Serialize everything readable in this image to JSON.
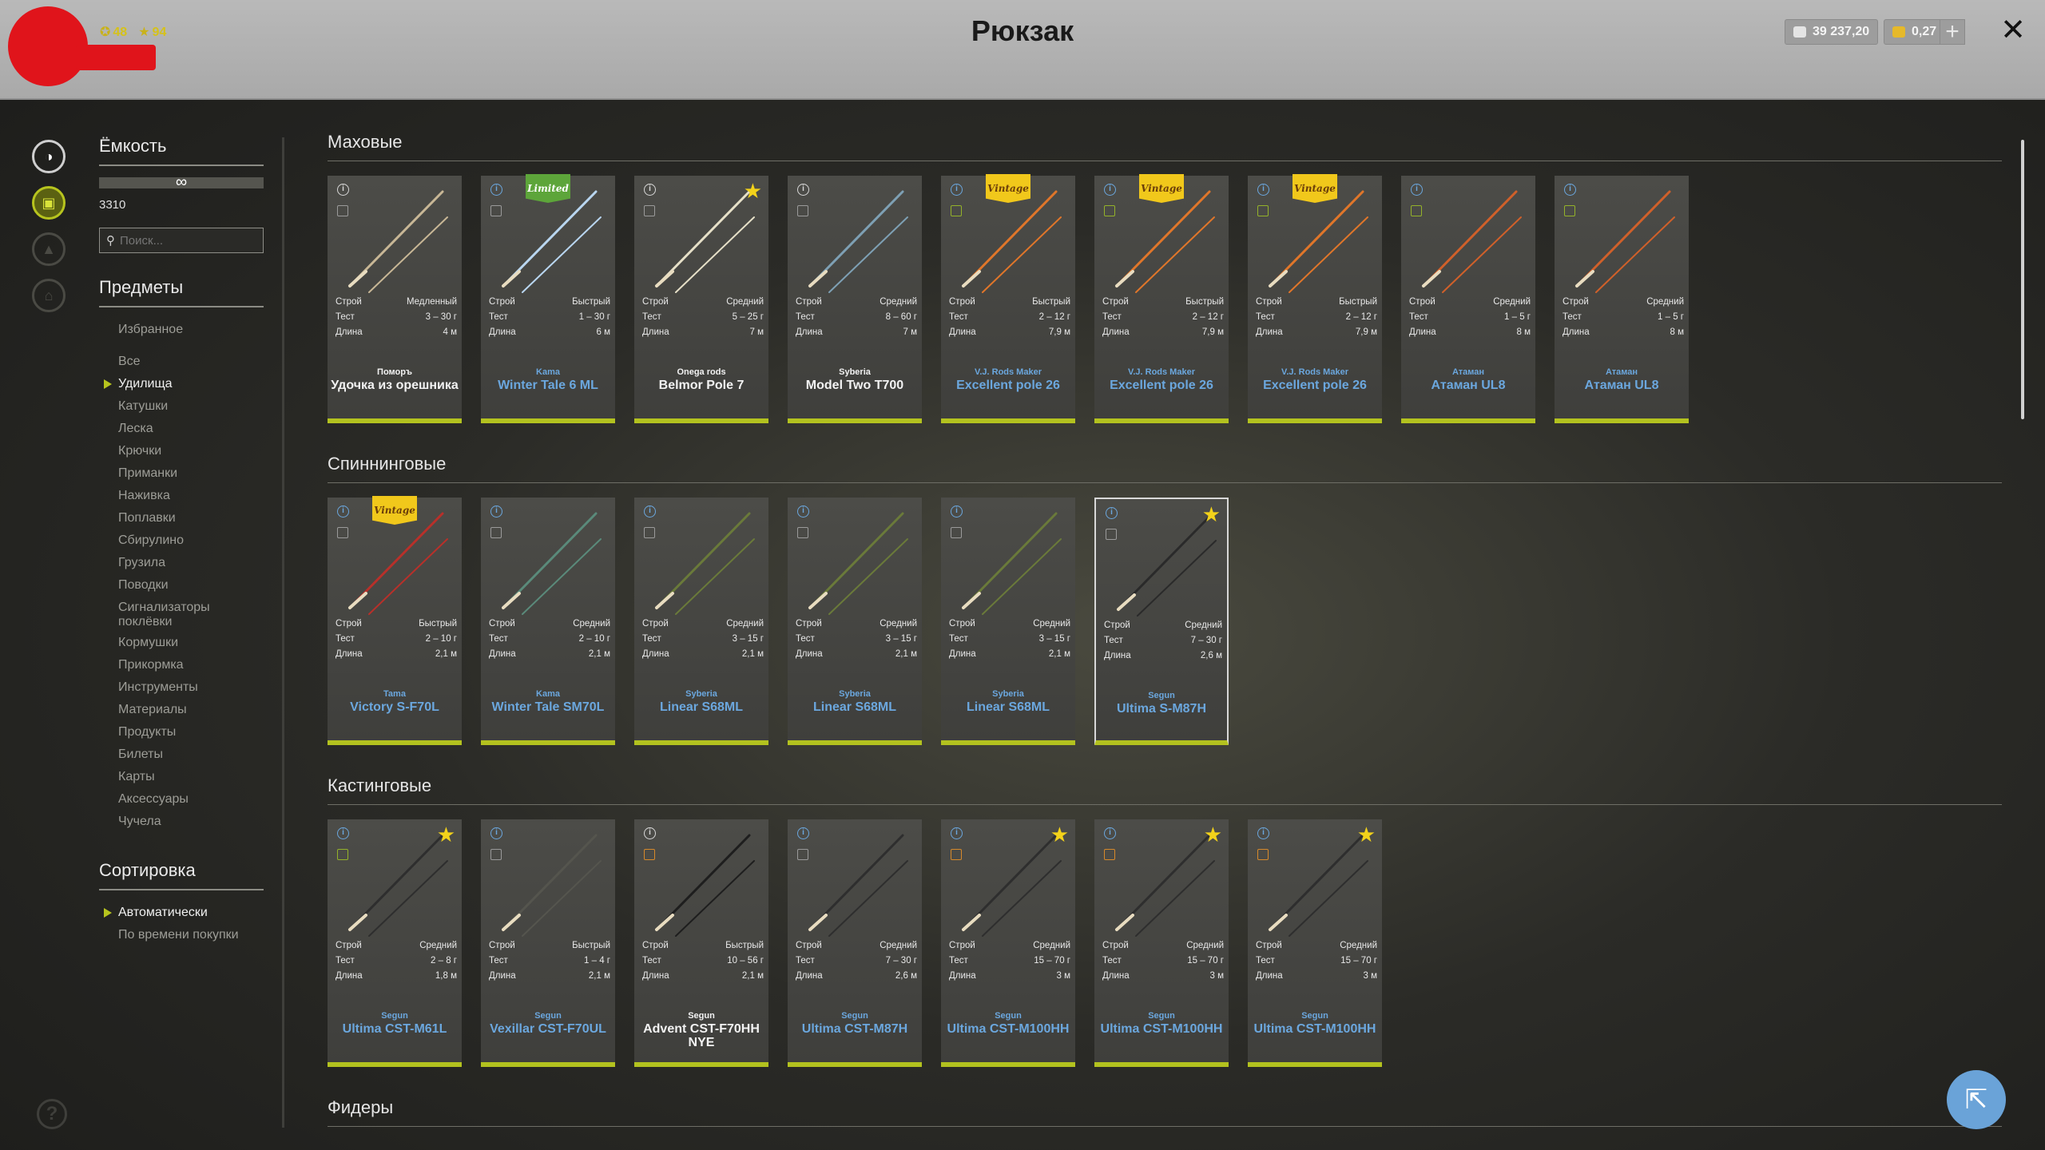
{
  "header": {
    "title": "Рюкзак",
    "level": "48",
    "rating": "94",
    "silver": "39 237,20",
    "gold": "0,27",
    "plus": "+",
    "close": "✕"
  },
  "sidebar": {
    "capacity_title": "Ёмкость",
    "capacity_bar": "∞",
    "capacity_value": "3310",
    "search_placeholder": "Поиск...",
    "items_title": "Предметы",
    "favorites": "Избранное",
    "items": [
      {
        "label": "Все",
        "active": false
      },
      {
        "label": "Удилища",
        "active": true
      },
      {
        "label": "Катушки",
        "active": false
      },
      {
        "label": "Леска",
        "active": false
      },
      {
        "label": "Крючки",
        "active": false
      },
      {
        "label": "Приманки",
        "active": false
      },
      {
        "label": "Наживка",
        "active": false
      },
      {
        "label": "Поплавки",
        "active": false
      },
      {
        "label": "Сбирулино",
        "active": false
      },
      {
        "label": "Грузила",
        "active": false
      },
      {
        "label": "Поводки",
        "active": false
      },
      {
        "label": "Сигнализаторы поклёвки",
        "active": false
      },
      {
        "label": "Кормушки",
        "active": false
      },
      {
        "label": "Прикормка",
        "active": false
      },
      {
        "label": "Инструменты",
        "active": false
      },
      {
        "label": "Материалы",
        "active": false
      },
      {
        "label": "Продукты",
        "active": false
      },
      {
        "label": "Билеты",
        "active": false
      },
      {
        "label": "Карты",
        "active": false
      },
      {
        "label": "Аксессуары",
        "active": false
      },
      {
        "label": "Чучела",
        "active": false
      }
    ],
    "sort_title": "Сортировка",
    "sort_options": [
      {
        "label": "Автоматически",
        "active": true
      },
      {
        "label": "По времени покупки",
        "active": false
      }
    ]
  },
  "spec_labels": {
    "action": "Строй",
    "test": "Тест",
    "length": "Длина"
  },
  "categories": [
    {
      "title": "Маховые",
      "items": [
        {
          "brand": "Поморъ",
          "model": "Удочка из орешника",
          "action": "Медленный",
          "test": "3 – 30 г",
          "length": "4 м",
          "white": true,
          "info_blue": false,
          "copy": "",
          "star": false,
          "badge": "",
          "rod": "#c8b796"
        },
        {
          "brand": "Kama",
          "model": "Winter Tale 6 ML",
          "action": "Быстрый",
          "test": "1 – 30 г",
          "length": "6 м",
          "white": false,
          "info_blue": true,
          "copy": "",
          "star": false,
          "badge": "Limited",
          "rod": "#b9d6f0"
        },
        {
          "brand": "Onega rods",
          "model": "Belmor Pole 7",
          "action": "Средний",
          "test": "5 – 25 г",
          "length": "7 м",
          "white": true,
          "info_blue": false,
          "copy": "",
          "star": true,
          "badge": "",
          "rod": "#e6e0c8"
        },
        {
          "brand": "Syberia",
          "model": "Model Two T700",
          "action": "Средний",
          "test": "8 – 60 г",
          "length": "7 м",
          "white": true,
          "info_blue": false,
          "copy": "",
          "star": false,
          "badge": "",
          "rod": "#7ea0b4"
        },
        {
          "brand": "V.J. Rods Maker",
          "model": "Excellent pole 26",
          "action": "Быстрый",
          "test": "2 – 12 г",
          "length": "7,9 м",
          "white": false,
          "info_blue": true,
          "copy": "green",
          "star": false,
          "badge": "Vintage",
          "rod": "#e0762a"
        },
        {
          "brand": "V.J. Rods Maker",
          "model": "Excellent pole 26",
          "action": "Быстрый",
          "test": "2 – 12 г",
          "length": "7,9 м",
          "white": false,
          "info_blue": true,
          "copy": "green",
          "star": false,
          "badge": "Vintage",
          "rod": "#e0762a"
        },
        {
          "brand": "V.J. Rods Maker",
          "model": "Excellent pole 26",
          "action": "Быстрый",
          "test": "2 – 12 г",
          "length": "7,9 м",
          "white": false,
          "info_blue": true,
          "copy": "green",
          "star": false,
          "badge": "Vintage",
          "rod": "#e0762a"
        },
        {
          "brand": "Атаман",
          "model": "Атаман UL8",
          "action": "Средний",
          "test": "1 – 5 г",
          "length": "8 м",
          "white": false,
          "info_blue": true,
          "copy": "green",
          "star": false,
          "badge": "",
          "rod": "#d0602a"
        },
        {
          "brand": "Атаман",
          "model": "Атаман UL8",
          "action": "Средний",
          "test": "1 – 5 г",
          "length": "8 м",
          "white": false,
          "info_blue": true,
          "copy": "green",
          "star": false,
          "badge": "",
          "rod": "#d0602a"
        }
      ]
    },
    {
      "title": "Спиннинговые",
      "items": [
        {
          "brand": "Tama",
          "model": "Victory S-F70L",
          "action": "Быстрый",
          "test": "2 – 10 г",
          "length": "2,1 м",
          "white": false,
          "info_blue": true,
          "copy": "",
          "star": false,
          "badge": "Vintage",
          "rod": "#b8302a"
        },
        {
          "brand": "Kama",
          "model": "Winter Tale SM70L",
          "action": "Средний",
          "test": "2 – 10 г",
          "length": "2,1 м",
          "white": false,
          "info_blue": true,
          "copy": "",
          "star": false,
          "badge": "",
          "rod": "#5a8a7a"
        },
        {
          "brand": "Syberia",
          "model": "Linear S68ML",
          "action": "Средний",
          "test": "3 – 15 г",
          "length": "2,1 м",
          "white": false,
          "info_blue": true,
          "copy": "",
          "star": false,
          "badge": "",
          "rod": "#6a7a3a"
        },
        {
          "brand": "Syberia",
          "model": "Linear S68ML",
          "action": "Средний",
          "test": "3 – 15 г",
          "length": "2,1 м",
          "white": false,
          "info_blue": true,
          "copy": "",
          "star": false,
          "badge": "",
          "rod": "#6a7a3a"
        },
        {
          "brand": "Syberia",
          "model": "Linear S68ML",
          "action": "Средний",
          "test": "3 – 15 г",
          "length": "2,1 м",
          "white": false,
          "info_blue": true,
          "copy": "",
          "star": false,
          "badge": "",
          "rod": "#6a7a3a"
        },
        {
          "brand": "Segun",
          "model": "Ultima S-M87H",
          "action": "Средний",
          "test": "7 – 30 г",
          "length": "2,6 м",
          "white": false,
          "info_blue": true,
          "copy": "",
          "star": true,
          "badge": "",
          "rod": "#2a2a2a",
          "selected": true
        }
      ]
    },
    {
      "title": "Кастинговые",
      "items": [
        {
          "brand": "Segun",
          "model": "Ultima CST-M61L",
          "action": "Средний",
          "test": "2 – 8 г",
          "length": "1,8 м",
          "white": false,
          "info_blue": true,
          "copy": "green",
          "star": true,
          "badge": "",
          "rod": "#2e2e2e"
        },
        {
          "brand": "Segun",
          "model": "Vexillar CST-F70UL",
          "action": "Быстрый",
          "test": "1 – 4 г",
          "length": "2,1 м",
          "white": false,
          "info_blue": true,
          "copy": "",
          "star": false,
          "badge": "",
          "rod": "#55554e"
        },
        {
          "brand": "Segun",
          "model": "Advent CST-F70HH NYE",
          "action": "Быстрый",
          "test": "10 – 56 г",
          "length": "2,1 м",
          "white": true,
          "info_blue": false,
          "copy": "orange",
          "star": false,
          "badge": "",
          "rod": "#1e1e1e"
        },
        {
          "brand": "Segun",
          "model": "Ultima CST-M87H",
          "action": "Средний",
          "test": "7 – 30 г",
          "length": "2,6 м",
          "white": false,
          "info_blue": true,
          "copy": "",
          "star": false,
          "badge": "",
          "rod": "#2e2e2e"
        },
        {
          "brand": "Segun",
          "model": "Ultima CST-M100HH",
          "action": "Средний",
          "test": "15 – 70 г",
          "length": "3 м",
          "white": false,
          "info_blue": true,
          "copy": "orange",
          "star": true,
          "badge": "",
          "rod": "#2e2e2e"
        },
        {
          "brand": "Segun",
          "model": "Ultima CST-M100HH",
          "action": "Средний",
          "test": "15 – 70 г",
          "length": "3 м",
          "white": false,
          "info_blue": true,
          "copy": "orange",
          "star": true,
          "badge": "",
          "rod": "#2e2e2e"
        },
        {
          "brand": "Segun",
          "model": "Ultima CST-M100HH",
          "action": "Средний",
          "test": "15 – 70 г",
          "length": "3 м",
          "white": false,
          "info_blue": true,
          "copy": "orange",
          "star": true,
          "badge": "",
          "rod": "#2e2e2e"
        }
      ]
    },
    {
      "title": "Фидеры",
      "items": []
    }
  ],
  "help": "?"
}
